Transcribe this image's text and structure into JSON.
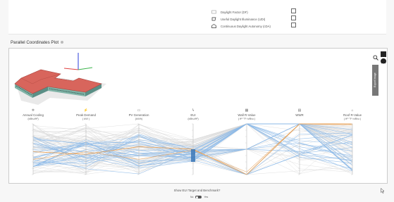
{
  "metrics": [
    {
      "label": "Daylight Factor (DF)",
      "icon": "daylight-factor-icon",
      "checked": false
    },
    {
      "label": "Useful Daylight Illuminance (UDI)",
      "icon": "udi-icon",
      "checked": false
    },
    {
      "label": "Continuous Daylight Autonomy (cDA)",
      "icon": "cda-icon",
      "checked": false
    }
  ],
  "panel": {
    "title": "Parallel Coordinates Plot"
  },
  "toolbar": {
    "export_label": "Export Image"
  },
  "axes": [
    {
      "name": "Annual Cooling",
      "unit": "(kBtu/ft²)",
      "icon": "cooling-icon"
    },
    {
      "name": "Peak Demand",
      "unit": "( kW )",
      "icon": "peak-demand-icon"
    },
    {
      "name": "PV Generation",
      "unit": "(kWh)",
      "icon": "pv-generation-icon"
    },
    {
      "name": "EUI",
      "unit": "(kBtu/ft²)",
      "icon": "eui-icon"
    },
    {
      "name": "Wall R-Value",
      "unit": "( ft²·°F·h/Btu )",
      "icon": "wall-icon"
    },
    {
      "name": "WWR",
      "unit": "",
      "icon": "wwr-icon"
    },
    {
      "name": "Roof R-Value",
      "unit": "( ft²·°F·h/Btu )",
      "icon": "roof-icon"
    }
  ],
  "footer": {
    "question": "Show EUI Target and Benchmark?",
    "no_label": "No",
    "yes_label": "Yes"
  },
  "colors": {
    "line_blue": "#8bb8e8",
    "line_grey": "#d9d9d9",
    "highlight": "#e8a35a",
    "roof": "#d8655c"
  }
}
